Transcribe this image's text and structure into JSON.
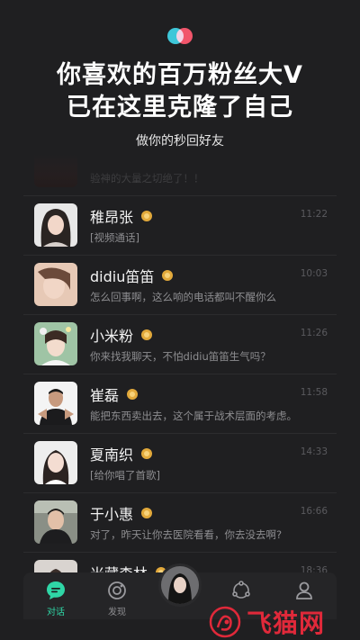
{
  "header": {
    "headline_line1": "你喜欢的百万粉丝大V",
    "headline_line2": "已在这里克隆了自己",
    "subtitle": "做你的秒回好友"
  },
  "chats": [
    {
      "name": "",
      "message": "验神的大量之切绝了！！",
      "time": "",
      "avatar": "dark-portrait"
    },
    {
      "name": "稚昂张",
      "message": "[视频通话]",
      "time": "11:22",
      "avatar": "girl-long-hair"
    },
    {
      "name": "didiu笛笛",
      "message": "怎么回事啊，这么响的电话都叫不醒你么",
      "time": "10:03",
      "avatar": "girl-selfie"
    },
    {
      "name": "小米粉",
      "message": "你来找我聊天，不怕didiu笛笛生气吗？",
      "time": "11:26",
      "avatar": "girl-flowers"
    },
    {
      "name": "崔磊",
      "message": "能把东西卖出去，这个属于战术层面的考虑。",
      "time": "11:58",
      "avatar": "man-suit"
    },
    {
      "name": "夏南织",
      "message": "[给你唱了首歌]",
      "time": "14:33",
      "avatar": "girl-white-top"
    },
    {
      "name": "于小惠",
      "message": "对了，昨天让你去医院看看，你去没去啊?",
      "time": "16:66",
      "avatar": "man-outdoor"
    },
    {
      "name": "米藏森林",
      "message": "",
      "time": "18:36",
      "avatar": "girl-partial"
    }
  ],
  "tabbar": {
    "chat_label": "对话",
    "discover_label": "发现"
  },
  "watermark": {
    "text": "飞猫网"
  },
  "colors": {
    "accent": "#2fd6a6",
    "background": "#1f1f21",
    "badge": "#e2a93b"
  }
}
